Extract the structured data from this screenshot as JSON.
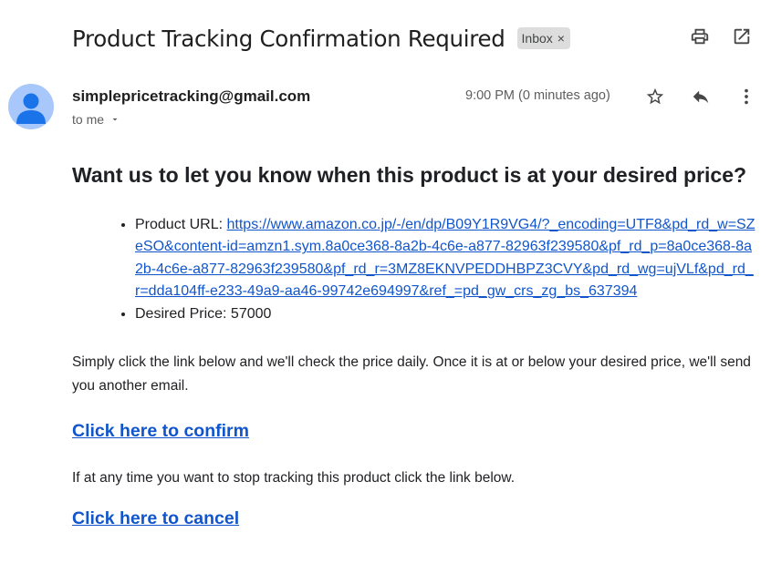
{
  "subject": "Product Tracking Confirmation Required",
  "label_badge": {
    "text": "Inbox",
    "remove_glyph": "×"
  },
  "toolbar": {
    "print_icon": "print-icon",
    "open_new_window_icon": "open-in-new-icon"
  },
  "message": {
    "sender": "simplepricetracking@gmail.com",
    "recipient_label": "to me",
    "time": "9:00 PM (0 minutes ago)",
    "star_icon": "star-icon",
    "reply_icon": "reply-icon",
    "more_icon": "more-vert-icon"
  },
  "body": {
    "heading": "Want us to let you know when this product is at your desired price?",
    "url_label": "Product URL:",
    "url": "https://www.amazon.co.jp/-/en/dp/B09Y1R9VG4/?_encoding=UTF8&pd_rd_w=SZeSO&content-id=amzn1.sym.8a0ce368-8a2b-4c6e-a877-82963f239580&pf_rd_p=8a0ce368-8a2b-4c6e-a877-82963f239580&pf_rd_r=3MZ8EKNVPEDDHBPZ3CVY&pd_rd_wg=ujVLf&pd_rd_r=dda104ff-e233-49a9-aa46-99742e694997&ref_=pd_gw_crs_zg_bs_637394",
    "price_line": "Desired Price: 57000",
    "instructions": "Simply click the link below and we'll check the price daily. Once it is at or below your desired price, we'll send you another email.",
    "confirm_link": "Click here to confirm",
    "stop_text": "If at any time you want to stop tracking this product click the link below.",
    "cancel_link": "Click here to cancel"
  },
  "colors": {
    "link": "#1155cc",
    "avatar_bg": "#a8c7fa",
    "avatar_fg": "#1a73e8",
    "badge_bg": "#dddddd"
  }
}
